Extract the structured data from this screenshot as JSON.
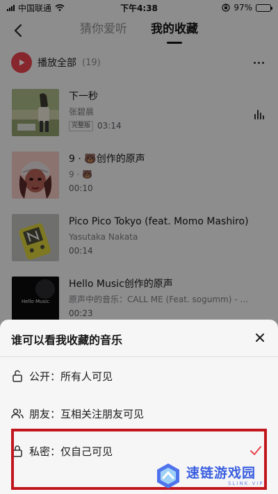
{
  "status_bar": {
    "carrier": "中国联通",
    "time": "下午4:38",
    "battery_percent": "97%",
    "battery_level": 0.97
  },
  "nav": {
    "back_icon": "chevron-left-icon",
    "tabs": [
      {
        "label": "猜你爱听",
        "active": false
      },
      {
        "label": "我的收藏",
        "active": true
      }
    ]
  },
  "play_all": {
    "label": "播放全部",
    "count": "(19)",
    "icon": "play-icon",
    "color": "#e8424f"
  },
  "songs": [
    {
      "title": "下一秒",
      "artist": "张碧晨",
      "badge": "完整版",
      "duration": "03:14",
      "playing": true
    },
    {
      "title": "9 · 🐻创作的原声",
      "artist": "9 · 🐻",
      "badge": "",
      "duration": "00:10"
    },
    {
      "title": "Pico Pico Tokyo (feat. Momo Mashiro)",
      "artist": "Yasutaka Nakata",
      "badge": "",
      "duration": "00:14"
    },
    {
      "title": "Hello Music创作的原声",
      "artist": "原声中的音乐：CALL ME (Feat. sogumm) - YLN...",
      "badge": "",
      "duration": "00:23",
      "cover_text": "Hello Music"
    }
  ],
  "sheet": {
    "title": "谁可以看我收藏的音乐",
    "options": [
      {
        "label": "公开：所有人可见",
        "icon": "unlock-icon",
        "selected": false
      },
      {
        "label": "朋友：互相关注朋友可见",
        "icon": "friends-icon",
        "selected": false
      },
      {
        "label": "私密：仅自己可见",
        "icon": "lock-icon",
        "selected": true
      }
    ],
    "highlight_color": "#c2161d",
    "check_color": "#e8424f"
  },
  "watermark": {
    "cn": "速链游戏园",
    "en": "SLINK.VIP"
  }
}
